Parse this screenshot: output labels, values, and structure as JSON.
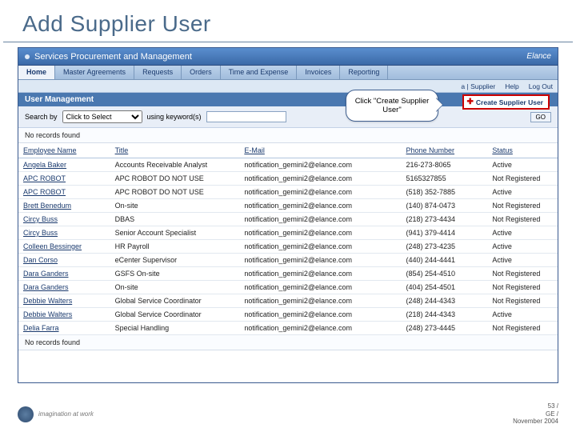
{
  "slide": {
    "title": "Add Supplier User"
  },
  "app_header": {
    "title": "Services Procurement and Management",
    "brand": "Elance"
  },
  "nav": [
    "Home",
    "Master Agreements",
    "Requests",
    "Orders",
    "Time and Expense",
    "Invoices",
    "Reporting"
  ],
  "subnav": {
    "supplier": "a | Supplier",
    "help": "Help",
    "logout": "Log Out"
  },
  "section_title": "User Management",
  "search": {
    "label": "Search by",
    "select_placeholder": "Click to Select",
    "keywords_label": "using keyword(s)",
    "go": "GO"
  },
  "create_button": "Create Supplier User",
  "no_records": "No records found",
  "callout": "Click \"Create Supplier User\"",
  "columns": [
    "Employee Name",
    "Title",
    "E-Mail",
    "Phone Number",
    "Status"
  ],
  "rows": [
    {
      "name": "Angela Baker",
      "title": "Accounts Receivable Analyst",
      "email": "notification_gemini2@elance.com",
      "phone": "216-273-8065",
      "status": "Active"
    },
    {
      "name": "APC ROBOT",
      "title": "APC ROBOT DO NOT USE",
      "email": "notification_gemini2@elance.com",
      "phone": "5165327855",
      "status": "Not Registered"
    },
    {
      "name": "APC ROBOT",
      "title": "APC ROBOT DO NOT USE",
      "email": "notification_gemini2@elance.com",
      "phone": "(518) 352-7885",
      "status": "Active"
    },
    {
      "name": "Brett Benedum",
      "title": "On-site",
      "email": "notification_gemini2@elance.com",
      "phone": "(140) 874-0473",
      "status": "Not Registered"
    },
    {
      "name": "Circy Buss",
      "title": "DBAS",
      "email": "notification_gemini2@elance.com",
      "phone": "(218) 273-4434",
      "status": "Not Registered"
    },
    {
      "name": "Circy Buss",
      "title": "Senior Account Specialist",
      "email": "notification_gemini2@elance.com",
      "phone": "(941) 379-4414",
      "status": "Active"
    },
    {
      "name": "Colleen Bessinger",
      "title": "HR Payroll",
      "email": "notification_gemini2@elance.com",
      "phone": "(248) 273-4235",
      "status": "Active"
    },
    {
      "name": "Dan Corso",
      "title": "eCenter Supervisor",
      "email": "notification_gemini2@elance.com",
      "phone": "(440) 244-4441",
      "status": "Active"
    },
    {
      "name": "Dara Ganders",
      "title": "GSFS On-site",
      "email": "notification_gemini2@elance.com",
      "phone": "(854) 254-4510",
      "status": "Not Registered"
    },
    {
      "name": "Dara Ganders",
      "title": "On-site",
      "email": "notification_gemini2@elance.com",
      "phone": "(404) 254-4501",
      "status": "Not Registered"
    },
    {
      "name": "Debbie Walters",
      "title": "Global Service Coordinator",
      "email": "notification_gemini2@elance.com",
      "phone": "(248) 244-4343",
      "status": "Not Registered"
    },
    {
      "name": "Debbie Walters",
      "title": "Global Service Coordinator",
      "email": "notification_gemini2@elance.com",
      "phone": "(218) 244-4343",
      "status": "Active"
    },
    {
      "name": "Delia Farra",
      "title": "Special Handling",
      "email": "notification_gemini2@elance.com",
      "phone": "(248) 273-4445",
      "status": "Not Registered"
    }
  ],
  "footer": {
    "tag": "imagination at work",
    "page": "53 /",
    "org": "GE /",
    "date": "November 2004"
  }
}
